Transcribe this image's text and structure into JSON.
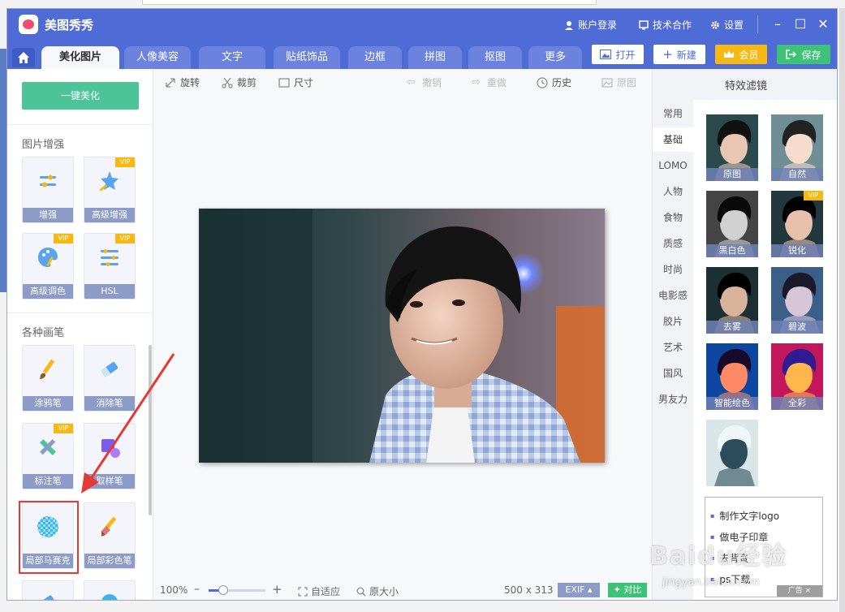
{
  "app": {
    "title": "美图秀秀"
  },
  "titlebar": {
    "login": "账户登录",
    "cooperation": "技术合作",
    "settings": "设置"
  },
  "tabs": [
    {
      "label": "美化图片",
      "active": true
    },
    {
      "label": "人像美容"
    },
    {
      "label": "文字"
    },
    {
      "label": "贴纸饰品"
    },
    {
      "label": "边框"
    },
    {
      "label": "拼图"
    },
    {
      "label": "抠图"
    },
    {
      "label": "更多"
    }
  ],
  "top_buttons": {
    "open": "打开",
    "new": "新建",
    "vip": "会员",
    "save": "保存"
  },
  "sidebar": {
    "beautify": "一键美化",
    "enhance_title": "图片增强",
    "enhance_tools": [
      {
        "label": "增强",
        "vip": false
      },
      {
        "label": "高级增强",
        "vip": true
      },
      {
        "label": "高级调色",
        "vip": true
      },
      {
        "label": "HSL",
        "vip": true
      }
    ],
    "brush_title": "各种画笔",
    "brush_tools": [
      {
        "label": "涂鸦笔",
        "vip": false
      },
      {
        "label": "消除笔",
        "vip": false
      },
      {
        "label": "标注笔",
        "vip": true
      },
      {
        "label": "取样笔",
        "vip": false
      },
      {
        "label": "局部马赛克",
        "vip": false
      },
      {
        "label": "局部彩色笔",
        "vip": false
      }
    ],
    "vip_badge": "VIP"
  },
  "toolbar": {
    "rotate": "旋转",
    "crop": "裁剪",
    "size": "尺寸",
    "undo": "撤销",
    "redo": "重做",
    "history": "历史",
    "original": "原图"
  },
  "status": {
    "zoom": "100%",
    "zoom_fraction": 0.25,
    "fit": "自适应",
    "actual": "原大小",
    "dimensions": "500 x 313",
    "exif": "EXIF ▴",
    "compare": "对比"
  },
  "filters": {
    "title": "特效滤镜",
    "categories": [
      "常用",
      "基础",
      "LOMO",
      "人物",
      "食物",
      "质感",
      "时尚",
      "电影感",
      "胶片",
      "艺术",
      "国风",
      "男友力"
    ],
    "active_category": "基础",
    "items": [
      {
        "label": "原图",
        "vip": false,
        "tone": "normal"
      },
      {
        "label": "自然",
        "vip": false,
        "tone": "bright"
      },
      {
        "label": "黑白色",
        "vip": false,
        "tone": "bw"
      },
      {
        "label": "锐化",
        "vip": true,
        "tone": "sharp"
      },
      {
        "label": "去雾",
        "vip": false,
        "tone": "dehaze"
      },
      {
        "label": "碧波",
        "vip": false,
        "tone": "teal"
      },
      {
        "label": "智能绘色",
        "vip": false,
        "tone": "vivid"
      },
      {
        "label": "全彩",
        "vip": false,
        "tone": "full"
      },
      {
        "label": "",
        "vip": false,
        "tone": "invert"
      }
    ]
  },
  "popup": {
    "items": [
      "制作文字logo",
      "做电子印章",
      "去背景",
      "ps下载"
    ],
    "ad": "广告 ×"
  },
  "watermark": {
    "main": "Baidu经验",
    "sub": "jingyan.baidu.com"
  },
  "colors": {
    "title_bar": "#4f6bd6",
    "beautify_green": "#4cc498",
    "save_green": "#3dc277",
    "vip_gold": "#f7b813",
    "highlight_red": "#e53935"
  }
}
